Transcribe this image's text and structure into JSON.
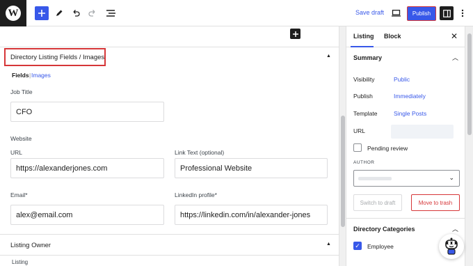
{
  "toolbar": {
    "logo": "wordpress-logo",
    "save_draft": "Save draft",
    "publish": "Publish"
  },
  "editor": {
    "metabox_title": "Directory Listing Fields / Images",
    "tabs": {
      "fields": "Fields",
      "separator": "|",
      "images": "Images"
    },
    "job_title_label": "Job Title",
    "job_title_value": "CFO",
    "website_label": "Website",
    "url_label": "URL",
    "url_value": "https://alexanderjones.com",
    "link_text_label": "Link Text (optional)",
    "link_text_value": "Professional Website",
    "email_label": "Email*",
    "email_value": "alex@email.com",
    "linkedin_label": "LinkedIn profile*",
    "linkedin_value": "https://linkedin.com/in/alexander-jones",
    "listing_owner_title": "Listing Owner",
    "listing_label": "Listing"
  },
  "sidebar": {
    "tab_listing": "Listing",
    "tab_block": "Block",
    "summary_title": "Summary",
    "visibility_label": "Visibility",
    "visibility_value": "Public",
    "publish_label": "Publish",
    "publish_value": "Immediately",
    "template_label": "Template",
    "template_value": "Single Posts",
    "url_label": "URL",
    "pending_review": "Pending review",
    "author_label": "AUTHOR",
    "switch_to_draft": "Switch to draft",
    "move_to_trash": "Move to trash",
    "categories_title": "Directory Categories",
    "category_employee": "Employee"
  },
  "colors": {
    "accent": "#3858e9",
    "danger": "#d63638",
    "dark": "#1e1e1e"
  }
}
